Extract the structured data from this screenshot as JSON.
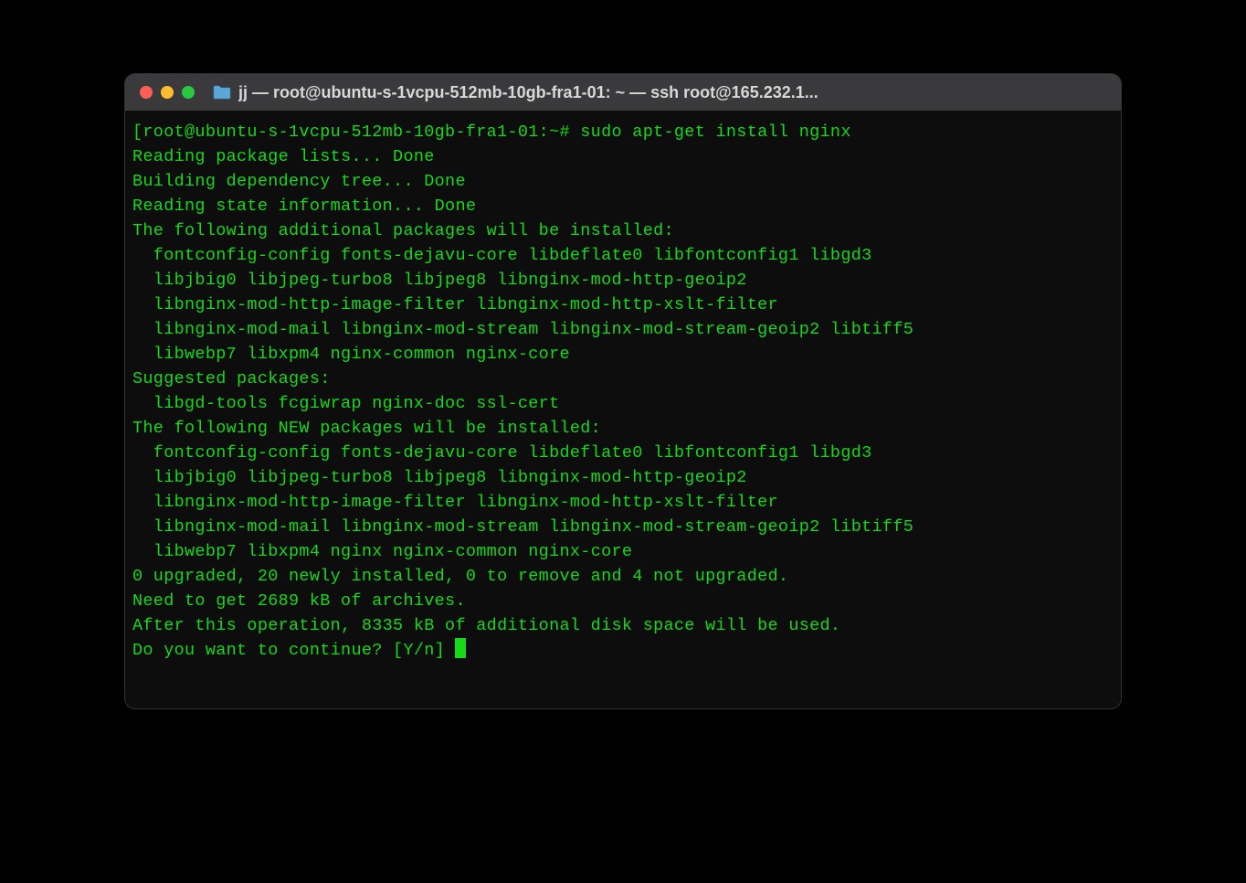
{
  "window": {
    "title": "jj — root@ubuntu-s-1vcpu-512mb-10gb-fra1-01: ~ — ssh root@165.232.1..."
  },
  "terminal": {
    "lines": [
      "[root@ubuntu-s-1vcpu-512mb-10gb-fra1-01:~# sudo apt-get install nginx                            ]",
      "Reading package lists... Done",
      "Building dependency tree... Done",
      "Reading state information... Done",
      "The following additional packages will be installed:",
      "  fontconfig-config fonts-dejavu-core libdeflate0 libfontconfig1 libgd3",
      "  libjbig0 libjpeg-turbo8 libjpeg8 libnginx-mod-http-geoip2",
      "  libnginx-mod-http-image-filter libnginx-mod-http-xslt-filter",
      "  libnginx-mod-mail libnginx-mod-stream libnginx-mod-stream-geoip2 libtiff5",
      "  libwebp7 libxpm4 nginx-common nginx-core",
      "Suggested packages:",
      "  libgd-tools fcgiwrap nginx-doc ssl-cert",
      "The following NEW packages will be installed:",
      "  fontconfig-config fonts-dejavu-core libdeflate0 libfontconfig1 libgd3",
      "  libjbig0 libjpeg-turbo8 libjpeg8 libnginx-mod-http-geoip2",
      "  libnginx-mod-http-image-filter libnginx-mod-http-xslt-filter",
      "  libnginx-mod-mail libnginx-mod-stream libnginx-mod-stream-geoip2 libtiff5",
      "  libwebp7 libxpm4 nginx nginx-common nginx-core",
      "0 upgraded, 20 newly installed, 0 to remove and 4 not upgraded.",
      "Need to get 2689 kB of archives.",
      "After this operation, 8335 kB of additional disk space will be used.",
      "Do you want to continue? [Y/n] "
    ]
  }
}
